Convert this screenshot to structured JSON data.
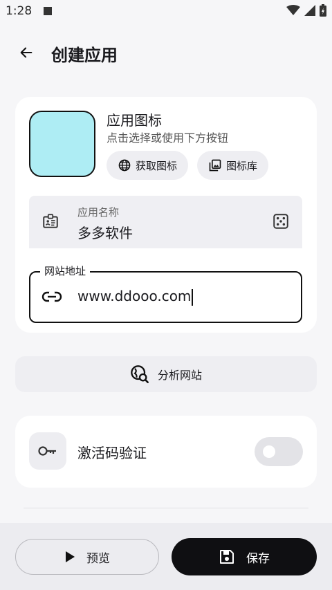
{
  "status": {
    "time": "1:28"
  },
  "header": {
    "title": "创建应用"
  },
  "icon_section": {
    "title": "应用图标",
    "hint": "点击选择或使用下方按钮",
    "preview_color": "#aeedf4",
    "fetch_label": "获取图标",
    "library_label": "图标库"
  },
  "name_field": {
    "label": "应用名称",
    "value": "多多软件"
  },
  "url_field": {
    "label": "网站地址",
    "value": "www.ddooo.com"
  },
  "analyze": {
    "label": "分析网站"
  },
  "activation": {
    "label": "激活码验证",
    "enabled": false
  },
  "actions": {
    "preview_label": "预览",
    "save_label": "保存"
  },
  "icons": {
    "back": "arrow-left-icon",
    "globe": "globe-icon",
    "gallery": "image-library-icon",
    "badge": "badge-icon",
    "dice": "dice-icon",
    "link": "link-icon",
    "analyze": "globe-search-icon",
    "key": "key-icon",
    "play": "play-icon",
    "save": "save-icon"
  }
}
